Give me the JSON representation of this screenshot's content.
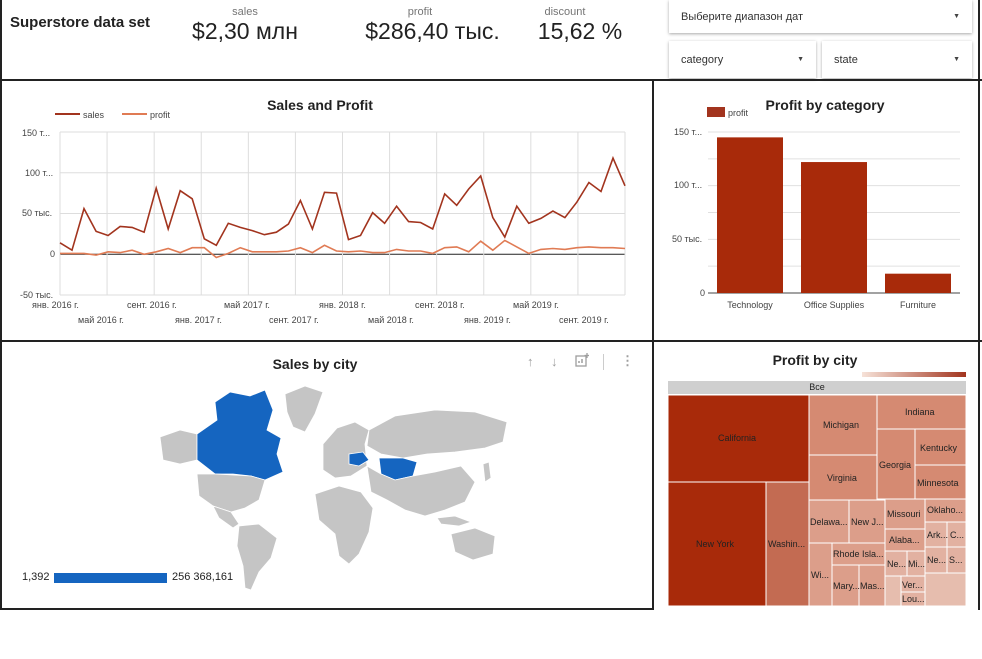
{
  "header": {
    "title": "Superstore data set",
    "kpis": [
      {
        "label": "sales",
        "value": "$2,30 млн"
      },
      {
        "label": "profit",
        "value": "$286,40 тыс."
      },
      {
        "label": "discount",
        "value": "15,62 %"
      }
    ],
    "controls": {
      "date_range": "Выберите диапазон дат",
      "category": "category",
      "state": "state"
    }
  },
  "sales_profit": {
    "title": "Sales and Profit",
    "legend": [
      "sales",
      "profit"
    ],
    "colors": {
      "sales": "#a2341e",
      "profit": "#e07b54"
    },
    "y_ticks": [
      "150 т...",
      "100 т...",
      "50 тыс.",
      "0",
      "-50 тыс."
    ],
    "x_ticks_top": [
      "янв. 2016 г.",
      "сент. 2016 г.",
      "май 2017 г.",
      "янв. 2018 г.",
      "сент. 2018 г.",
      "май 2019 г."
    ],
    "x_ticks_bottom": [
      "май 2016 г.",
      "янв. 2017 г.",
      "сент. 2017 г.",
      "май 2018 г.",
      "янв. 2019 г.",
      "сент. 2019 г."
    ]
  },
  "profit_category": {
    "title": "Profit by category",
    "legend": "profit",
    "y_ticks": [
      "150 т...",
      "100 т...",
      "50 тыс.",
      "0"
    ]
  },
  "sales_city": {
    "title": "Sales by city",
    "legend_min": "1,392",
    "legend_max": "256 368,161",
    "icons": [
      "arrow-up-icon",
      "arrow-down-icon",
      "chart-add-icon",
      "more-vert-icon"
    ]
  },
  "profit_city": {
    "title": "Profit by city",
    "root_label": "Все",
    "cells": [
      "California",
      "New York",
      "Washin...",
      "Michigan",
      "Virginia",
      "Indiana",
      "Georgia",
      "Kentucky",
      "Minnesota",
      "Delawa...",
      "New J...",
      "Missouri",
      "Oklaho...",
      "Alaba...",
      "Ark...",
      "C...",
      "Rhode Isla...",
      "Wi...",
      "Mary...",
      "Mas...",
      "Ne...",
      "Mi...",
      "Ne...",
      "Ver...",
      "S...",
      "Lou..."
    ]
  },
  "chart_data": [
    {
      "type": "line",
      "title": "Sales and Profit",
      "x_start": "2016-01",
      "x_end": "2019-12",
      "ylim": [
        -50000,
        150000
      ],
      "series": [
        {
          "name": "sales",
          "values": [
            14000,
            5000,
            56000,
            28000,
            23000,
            34000,
            33000,
            27000,
            81000,
            31000,
            78000,
            68000,
            19000,
            11000,
            38000,
            33000,
            29000,
            24000,
            27000,
            37000,
            66000,
            31000,
            76000,
            75000,
            18000,
            23000,
            51000,
            38000,
            59000,
            40000,
            39000,
            31000,
            74000,
            60000,
            80000,
            96000,
            45000,
            21000,
            59000,
            38000,
            44000,
            53000,
            45000,
            64000,
            88000,
            77000,
            118000,
            84000
          ]
        },
        {
          "name": "profit",
          "values": [
            1000,
            1000,
            1000,
            -1000,
            3000,
            2000,
            5000,
            0,
            3000,
            7000,
            2000,
            8000,
            8000,
            -4000,
            1000,
            8000,
            3000,
            3000,
            3000,
            4000,
            8000,
            2000,
            11000,
            4000,
            3000,
            4000,
            2000,
            2000,
            6000,
            4000,
            4000,
            1000,
            8000,
            9000,
            3000,
            16000,
            5000,
            17000,
            9000,
            1000,
            6000,
            7000,
            6000,
            8000,
            9000,
            8000,
            8000,
            7000
          ]
        }
      ]
    },
    {
      "type": "bar",
      "title": "Profit by category",
      "categories": [
        "Technology",
        "Office Supplies",
        "Furniture"
      ],
      "series": [
        {
          "name": "profit",
          "values": [
            145000,
            122000,
            18000
          ]
        }
      ],
      "ylim": [
        0,
        150000
      ]
    }
  ]
}
